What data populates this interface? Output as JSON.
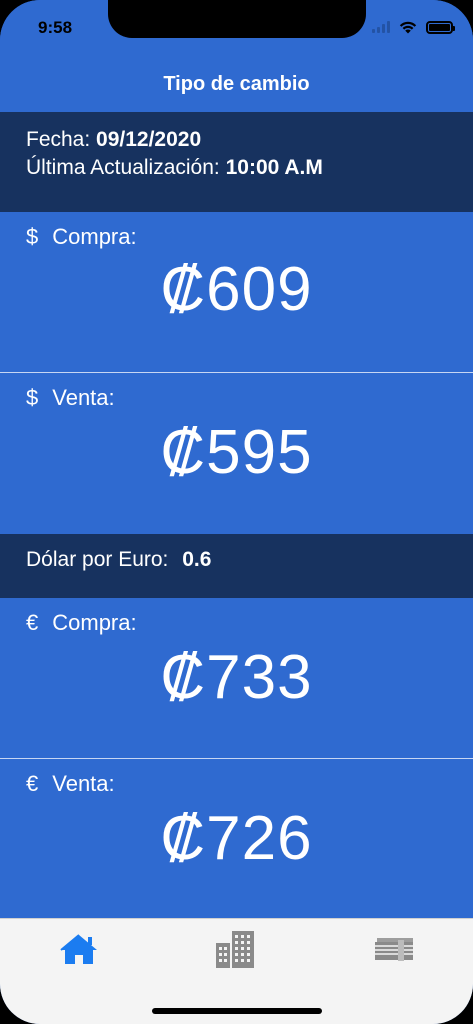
{
  "status_bar": {
    "time": "9:58"
  },
  "header": {
    "title": "Tipo de cambio"
  },
  "date_info": {
    "fecha_label": "Fecha:",
    "fecha_value": "09/12/2020",
    "update_label": "Última Actualización:",
    "update_value": "10:00 A.M"
  },
  "dollar": {
    "symbol": "$",
    "buy_label": "Compra:",
    "buy_value": "₡609",
    "sell_label": "Venta:",
    "sell_value": "₡595"
  },
  "euro_rate": {
    "label": "Dólar por Euro:",
    "value": "0.6"
  },
  "euro": {
    "symbol": "€",
    "buy_label": "Compra:",
    "buy_value": "₡733",
    "sell_label": "Venta:",
    "sell_value": "₡726"
  },
  "tabs": [
    {
      "icon": "home-icon",
      "active": true
    },
    {
      "icon": "buildings-icon",
      "active": false
    },
    {
      "icon": "money-stack-icon",
      "active": false
    }
  ],
  "colors": {
    "primary_blue": "#2f6ad0",
    "dark_band": "#17325f",
    "tab_active": "#1b7cf0",
    "tab_inactive": "#8a8a8a"
  }
}
